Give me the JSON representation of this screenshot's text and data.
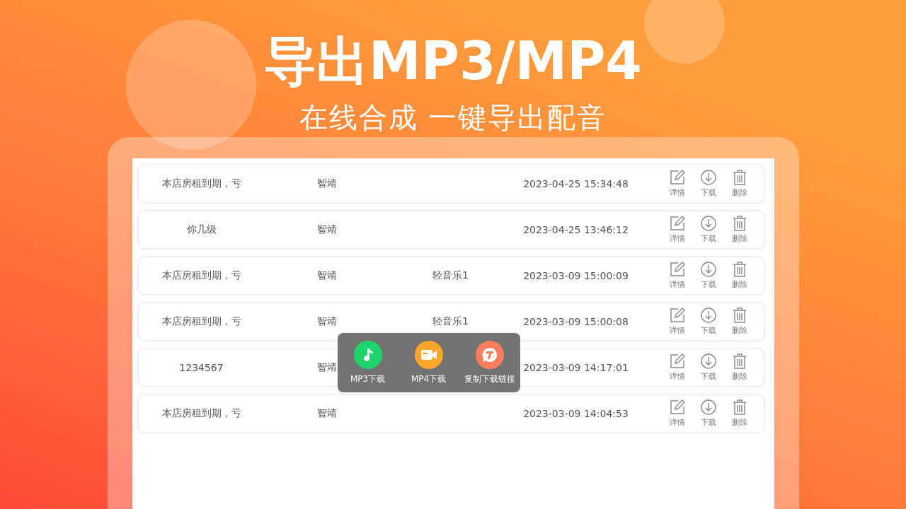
{
  "headline": "导出MP3/MP4",
  "subheadline": "在线合成 一键导出配音",
  "records": [
    {
      "title": "本店房租到期，亏",
      "voice": "智靖",
      "date": "2023-04-25 15:34:48",
      "actions": [
        {
          "kind": "edit",
          "label": "详情"
        },
        {
          "kind": "download",
          "label": "下载"
        },
        {
          "kind": "delete",
          "label": "删除"
        }
      ]
    },
    {
      "title": "你几级",
      "voice": "智靖",
      "date": "2023-04-25 13:46:12",
      "actions": [
        {
          "kind": "edit",
          "label": "详情"
        },
        {
          "kind": "download",
          "label": "下载"
        },
        {
          "kind": "delete",
          "label": "删除"
        }
      ]
    },
    {
      "title": "本店房租到期，亏",
      "voice": "智靖",
      "music": "轻音乐1",
      "date": "2023-03-09 15:00:09",
      "actions": [
        {
          "kind": "edit",
          "label": "详情"
        },
        {
          "kind": "download",
          "label": "下载"
        },
        {
          "kind": "delete",
          "label": "删除"
        }
      ]
    },
    {
      "title": "本店房租到期，亏",
      "voice": "智靖",
      "music": "轻音乐1",
      "date": "2023-03-09 15:00:08",
      "actions": [
        {
          "kind": "edit",
          "label": "详情"
        },
        {
          "kind": "download",
          "label": "下载"
        },
        {
          "kind": "delete",
          "label": "删除"
        }
      ]
    },
    {
      "title": "1234567",
      "voice": "智靖",
      "date": "2023-03-09 14:17:01",
      "actions": [
        {
          "kind": "edit",
          "label": "详情"
        },
        {
          "kind": "download",
          "label": "下载"
        },
        {
          "kind": "delete",
          "label": "删除"
        }
      ]
    },
    {
      "title": "本店房租到期，亏",
      "voice": "智靖",
      "date": "2023-03-09 14:04:53",
      "actions": [
        {
          "kind": "edit",
          "label": "详情"
        },
        {
          "kind": "download",
          "label": "下载"
        },
        {
          "kind": "delete",
          "label": "删除"
        }
      ]
    }
  ],
  "export_menu": [
    {
      "kind": "music",
      "label": "MP3下载",
      "color": "#1fd36b"
    },
    {
      "kind": "video",
      "label": "MP4下载",
      "color": "#ffa62b"
    },
    {
      "kind": "link",
      "label": "复制下载链接",
      "color": "#ff7d5c"
    }
  ]
}
